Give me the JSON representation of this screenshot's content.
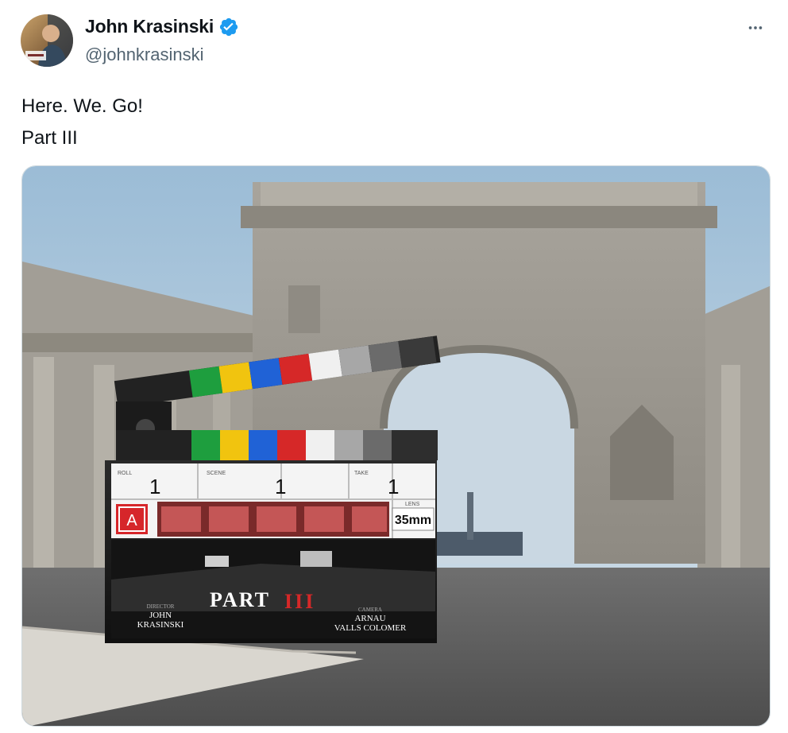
{
  "tweet": {
    "author": {
      "display_name": "John Krasinski",
      "handle": "@johnkrasinski",
      "verified": true,
      "avatar_icon": "avatar-image",
      "verified_icon": "verified-badge-icon",
      "verified_color": "#1d9bf0"
    },
    "more_icon": "more-horizontal-icon",
    "text_lines": [
      "Here. We. Go!",
      "Part III"
    ],
    "media": {
      "description_icon": "photo",
      "slate": {
        "roll_label": "ROLL",
        "roll_value": "1",
        "scene_label": "SCENE",
        "scene_value": "1",
        "take_label": "TAKE",
        "take_value": "1",
        "camera_letter": "A",
        "lens_label": "LENS",
        "lens_value": "35mm",
        "title_part": "PART",
        "title_number": "III",
        "director_label": "DIRECTOR",
        "director_line1": "JOHN",
        "director_line2": "KRASINSKI",
        "camera_label": "CAMERA",
        "camera_line1": "ARNAU",
        "camera_line2": "VALLS COLOMER"
      }
    }
  }
}
